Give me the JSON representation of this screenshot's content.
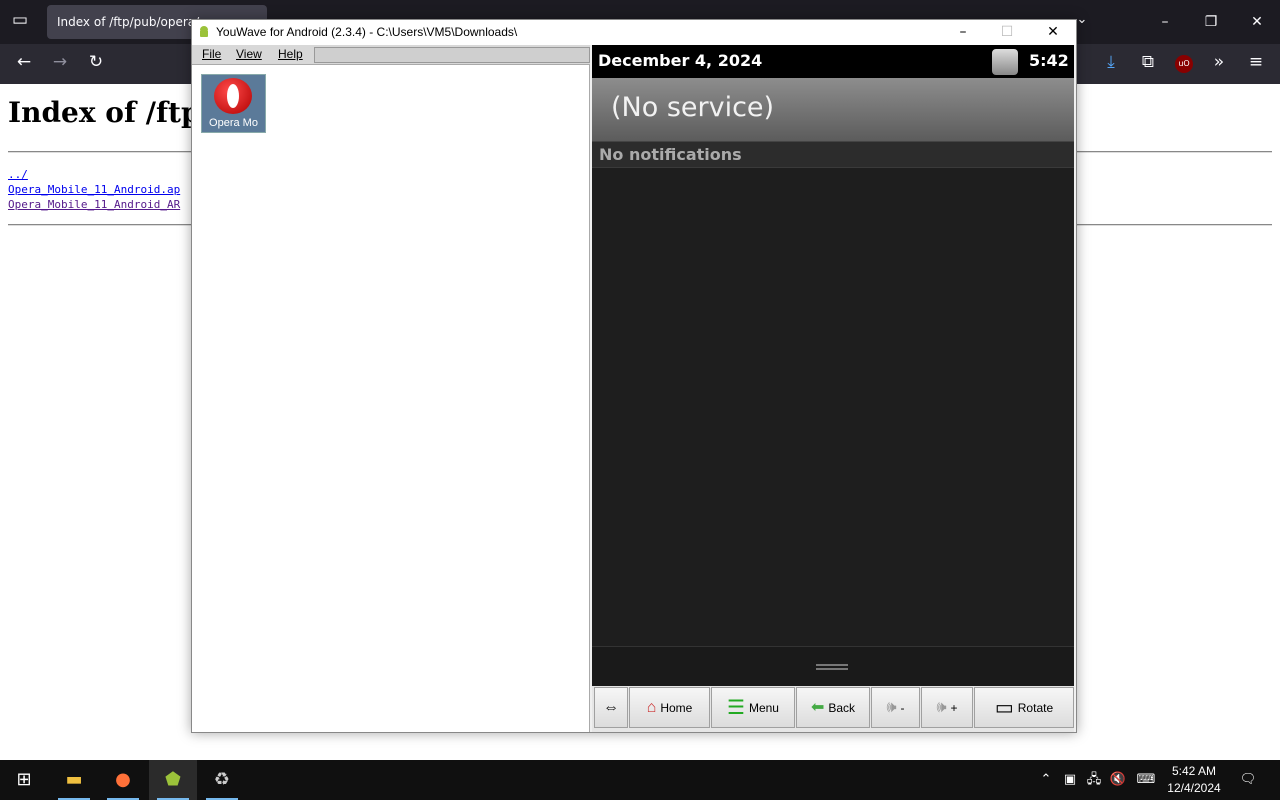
{
  "browser": {
    "tab_title": "Index of /ftp/pub/opera/",
    "icons": {
      "tabs_list": "tab-list-icon",
      "back": "arrow-left-icon",
      "forward": "arrow-right-icon",
      "reload": "reload-icon",
      "download": "download-icon",
      "extensions": "extensions-icon",
      "ublock": "ublock-icon",
      "more": "chevron-double-right-icon",
      "menu": "hamburger-icon"
    },
    "ublock_label": "uO",
    "window_controls": {
      "minimize": "–",
      "restore": "❐",
      "close": "✕"
    }
  },
  "page": {
    "title": "Index of /ftp/p",
    "entries": [
      {
        "label": "../"
      },
      {
        "label": "Opera_Mobile_11_Android.ap"
      },
      {
        "label": "Opera_Mobile_11_Android_AR"
      }
    ]
  },
  "youwave": {
    "title": "YouWave for Android (2.3.4) - C:\\Users\\VM5\\Downloads\\",
    "controls": {
      "minimize": "–",
      "maximize": "☐",
      "close": "✕"
    },
    "menu": {
      "file": "File",
      "view": "View",
      "help": "Help"
    },
    "apps": [
      {
        "label": "Opera Mo"
      }
    ],
    "android": {
      "date": "December 4, 2024",
      "time": "5:42",
      "carrier": "(No service)",
      "notifications": "No notifications"
    },
    "buttons": {
      "resize": "⇔",
      "home": "Home",
      "menu": "Menu",
      "back": "Back",
      "vol_down": "-",
      "vol_up": "+",
      "rotate": "Rotate"
    }
  },
  "taskbar": {
    "clock_time": "5:42 AM",
    "clock_date": "12/4/2024",
    "apps": [
      "start-icon",
      "file-explorer-icon",
      "firefox-icon",
      "youwave-icon",
      "recycle-bin-icon"
    ],
    "accent": "#76b9ed"
  },
  "colors": {
    "android_status": "#000000",
    "link": "#0000ee",
    "visited_link": "#551a8b"
  }
}
